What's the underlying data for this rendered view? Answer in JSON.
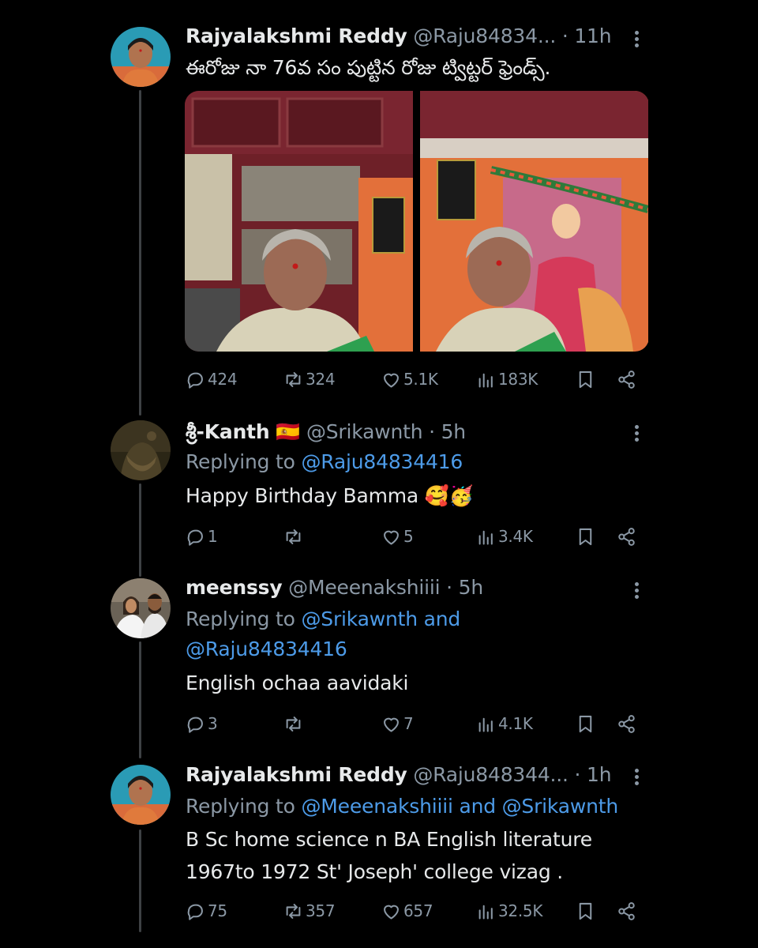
{
  "tweets": [
    {
      "name": "Rajyalakshmi Reddy",
      "handle": "@Raju84834...",
      "time": "· 11h",
      "text": "ఈరోజు నా 76వ సం పుట్టిన రోజు  ట్విట్టర్ ఫ్రెండ్స్.",
      "stats": {
        "replies": "424",
        "retweets": "324",
        "likes": "5.1K",
        "views": "183K"
      }
    },
    {
      "name": "శ్రీ-Kanth",
      "flag": "🇪🇸",
      "handle": "@Srikawnth",
      "time": "· 5h",
      "replying_prefix": "Replying to",
      "replying_to": "@Raju84834416",
      "text": "Happy Birthday Bamma",
      "emojis": "🥰🥳",
      "stats": {
        "replies": "1",
        "retweets": "",
        "likes": "5",
        "views": "3.4K"
      }
    },
    {
      "name": "meenssy",
      "handle": "@Meeenakshiiii",
      "time": "· 5h",
      "replying_prefix": "Replying to",
      "replying_to_line1": "@Srikawnth and",
      "replying_to_line2": "@Raju84834416",
      "text": "English ochaa aavidaki",
      "stats": {
        "replies": "3",
        "retweets": "",
        "likes": "7",
        "views": "4.1K"
      }
    },
    {
      "name": "Rajyalakshmi Reddy",
      "handle": "@Raju848344...",
      "time": "· 1h",
      "replying_prefix": "Replying to",
      "replying_to": "@Meeenakshiiii and @Srikawnth",
      "text_line1": "B Sc home science n BA English literature",
      "text_line2": "1967to 1972 St' Joseph' college vizag .",
      "stats": {
        "replies": "75",
        "retweets": "357",
        "likes": "657",
        "views": "32.5K"
      }
    }
  ],
  "icons": {
    "reply": "speech-bubble-icon",
    "retweet": "retweet-arrows-icon",
    "like": "heart-icon",
    "views": "bar-chart-icon",
    "bookmark": "bookmark-icon",
    "share": "share-nodes-icon",
    "more": "more-dots-icon"
  },
  "colors": {
    "background": "#000000",
    "text": "#e7e9ea",
    "muted": "#8b98a5",
    "link": "#4d9be8",
    "thread_line": "#3e4144"
  }
}
